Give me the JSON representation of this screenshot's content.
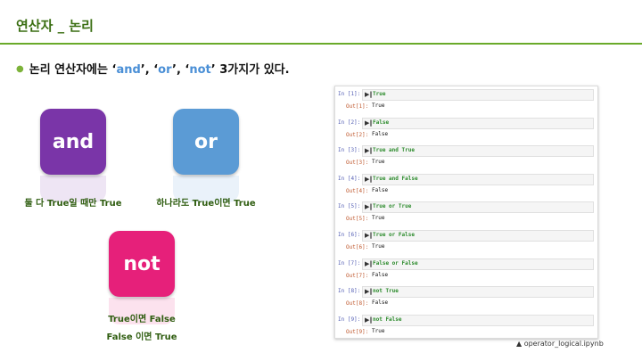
{
  "slide": {
    "title": "연산자 _ 논리",
    "bullet": {
      "pre": "논리 연산자에는 ‘",
      "k1": "and",
      "s1": "’, ‘",
      "k2": "or",
      "s2": "’, ‘",
      "k3": "not",
      "post": "’ 3가지가 있다."
    }
  },
  "operators": [
    {
      "label": "and",
      "color": "#7a35a8",
      "desc1": "둘 다 True일 때만 True",
      "desc2": ""
    },
    {
      "label": "or",
      "color": "#5b9bd5",
      "desc1": "하나라도 True이면 True",
      "desc2": ""
    },
    {
      "label": "not",
      "color": "#e6207a",
      "desc1": "True이면 False",
      "desc2": "False 이면 True"
    }
  ],
  "notebook": {
    "cells": [
      {
        "in_prompt": "In [1]:",
        "code": "True",
        "out_prompt": "Out[1]:",
        "output": "True"
      },
      {
        "in_prompt": "In [2]:",
        "code": "False",
        "out_prompt": "Out[2]:",
        "output": "False"
      },
      {
        "in_prompt": "In [3]:",
        "code": "True and True",
        "out_prompt": "Out[3]:",
        "output": "True"
      },
      {
        "in_prompt": "In [4]:",
        "code": "True and False",
        "out_prompt": "Out[4]:",
        "output": "False"
      },
      {
        "in_prompt": "In [5]:",
        "code": "True or True",
        "out_prompt": "Out[5]:",
        "output": "True"
      },
      {
        "in_prompt": "In [6]:",
        "code": "True or False",
        "out_prompt": "Out[6]:",
        "output": "True"
      },
      {
        "in_prompt": "In [7]:",
        "code": "False or False",
        "out_prompt": "Out[7]:",
        "output": "False"
      },
      {
        "in_prompt": "In [8]:",
        "code": "not True",
        "out_prompt": "Out[8]:",
        "output": "False"
      },
      {
        "in_prompt": "In [9]:",
        "code": "not False",
        "out_prompt": "Out[9]:",
        "output": "True"
      }
    ],
    "run_icon": "run-cell-icon"
  },
  "caption": "▲ operator_logical.ipynb"
}
